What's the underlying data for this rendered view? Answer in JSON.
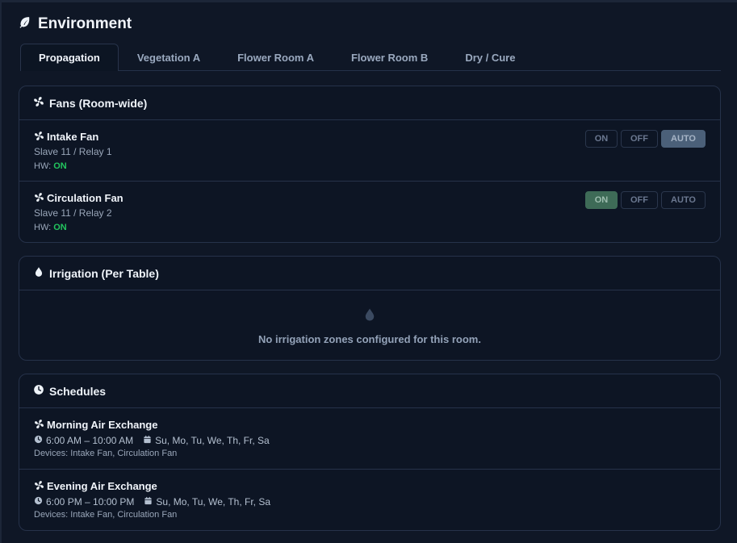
{
  "header": {
    "title": "Environment",
    "icon": "leaf-icon"
  },
  "tabs": [
    {
      "label": "Propagation",
      "active": true
    },
    {
      "label": "Vegetation A",
      "active": false
    },
    {
      "label": "Flower Room A",
      "active": false
    },
    {
      "label": "Flower Room B",
      "active": false
    },
    {
      "label": "Dry / Cure",
      "active": false
    }
  ],
  "fans": {
    "title": "Fans (Room-wide)",
    "items": [
      {
        "name": "Intake Fan",
        "location": "Slave 11 / Relay 1",
        "hw_label": "HW:",
        "hw_state": "ON",
        "mode": "AUTO",
        "modes": [
          "ON",
          "OFF",
          "AUTO"
        ]
      },
      {
        "name": "Circulation Fan",
        "location": "Slave 11 / Relay 2",
        "hw_label": "HW:",
        "hw_state": "ON",
        "mode": "ON",
        "modes": [
          "ON",
          "OFF",
          "AUTO"
        ]
      }
    ]
  },
  "irrigation": {
    "title": "Irrigation (Per Table)",
    "empty_message": "No irrigation zones configured for this room."
  },
  "schedules": {
    "title": "Schedules",
    "items": [
      {
        "name": "Morning Air Exchange",
        "time": "6:00 AM – 10:00 AM",
        "days": "Su, Mo, Tu, We, Th, Fr, Sa",
        "devices": "Devices: Intake Fan, Circulation Fan"
      },
      {
        "name": "Evening Air Exchange",
        "time": "6:00 PM – 10:00 PM",
        "days": "Su, Mo, Tu, We, Th, Fr, Sa",
        "devices": "Devices: Intake Fan, Circulation Fan"
      }
    ]
  },
  "colors": {
    "background": "#0f1726",
    "card": "#0d1524",
    "border": "#26324a",
    "hw_on": "#22c55e",
    "auto_active": "#4b6079",
    "on_active": "#3e6b57"
  }
}
